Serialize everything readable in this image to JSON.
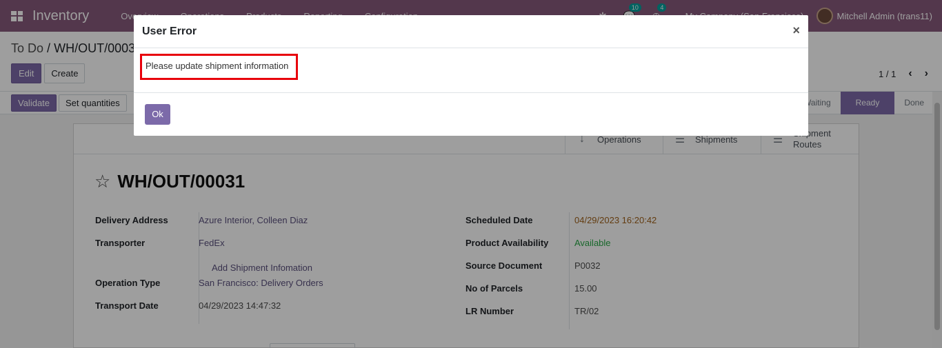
{
  "navbar": {
    "app_name": "Inventory",
    "menu": [
      "Overview",
      "Operations",
      "Products",
      "Reporting",
      "Configuration"
    ],
    "messages_count": "10",
    "activities_count": "4",
    "company": "My Company (San Francisco)",
    "user": "Mitchell Admin (trans11)"
  },
  "control_panel": {
    "breadcrumb_parent": "To Do",
    "breadcrumb_sep": "/",
    "breadcrumb_current": "WH/OUT/00031",
    "edit_label": "Edit",
    "create_label": "Create",
    "pager_value": "1 / 1"
  },
  "statusbar": {
    "validate_label": "Validate",
    "set_quantities_label": "Set quantities",
    "stages": [
      "Waiting",
      "Ready",
      "Done"
    ],
    "active_stage": "Ready"
  },
  "smart_buttons": {
    "operations": "Operations",
    "shipments": "Shipments",
    "routes_top": "Shipment",
    "routes": "Routes"
  },
  "record": {
    "name": "WH/OUT/00031",
    "left_fields": [
      {
        "label": "Delivery Address",
        "value": "Azure Interior, Colleen Diaz"
      },
      {
        "label": "Transporter",
        "value": "FedEx"
      },
      {
        "label": "Operation Type",
        "value": "San Francisco: Delivery Orders"
      },
      {
        "label": "Transport Date",
        "value": "04/29/2023 14:47:32"
      }
    ],
    "add_shipment_link": "Add Shipment Infomation",
    "right_fields": [
      {
        "label": "Scheduled Date",
        "value": "04/29/2023 16:20:42"
      },
      {
        "label": "Product Availability",
        "value": "Available"
      },
      {
        "label": "Source Document",
        "value": "P0032"
      },
      {
        "label": "No of Parcels",
        "value": "15.00"
      },
      {
        "label": "LR Number",
        "value": "TR/02"
      }
    ]
  },
  "dialog": {
    "title": "User Error",
    "close_glyph": "×",
    "message": "Please update shipment information",
    "ok_label": "Ok"
  },
  "colors": {
    "brand": "#875a7b",
    "primary_button": "#7c6aa9",
    "highlight_border": "#e8000b"
  }
}
